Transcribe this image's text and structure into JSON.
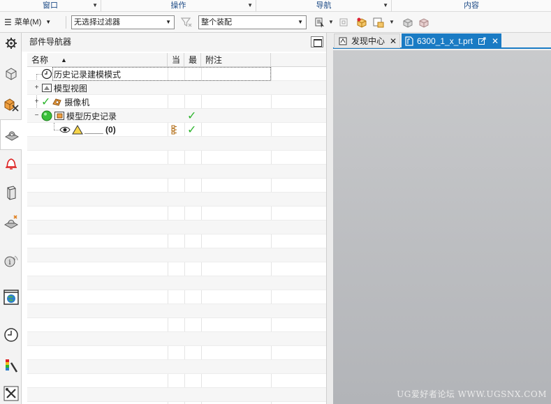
{
  "ribbon_groups": [
    {
      "label": "窗口",
      "width": 145
    },
    {
      "label": "操作",
      "width": 222
    },
    {
      "label": "导航",
      "width": 194
    },
    {
      "label": "内容",
      "width": 228
    }
  ],
  "toolbar": {
    "menu_label": "菜单(M)",
    "filter_select": "无选择过滤器",
    "scope_select": "整个装配"
  },
  "navigator": {
    "title": "部件导航器",
    "columns": {
      "name": "名称",
      "current": "当",
      "latest": "最",
      "notes": "附注"
    },
    "rows": [
      {
        "label": "历史记录建模模式"
      },
      {
        "label": "模型视图"
      },
      {
        "label": "摄像机"
      },
      {
        "label": "模型历史记录"
      },
      {
        "label": "____ (0)"
      }
    ]
  },
  "tabs": [
    {
      "label": "发现中心"
    },
    {
      "label": "6300_1_x_t.prt"
    }
  ],
  "watermark": "UG爱好者论坛 WWW.UGSNX.COM",
  "colors": {
    "accent": "#1a7bc4",
    "check": "#2db52d",
    "group_text": "#1c4a86"
  }
}
